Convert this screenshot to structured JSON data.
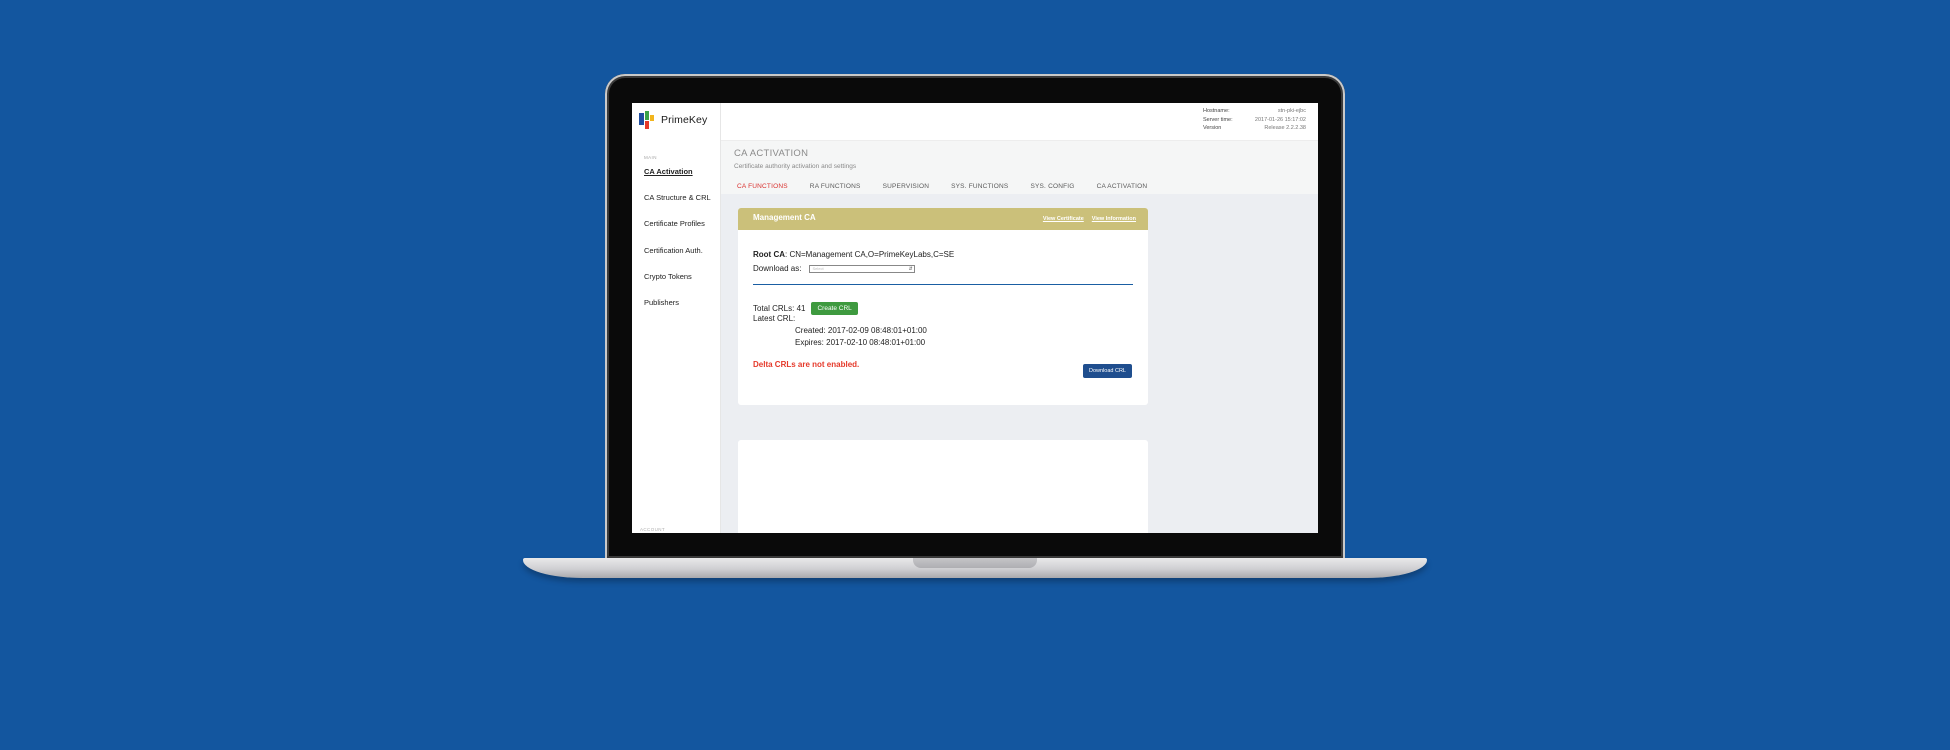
{
  "app": {
    "brand": "PrimeKey"
  },
  "server": {
    "hostname_label": "Hostname:",
    "hostname_value": "stn-pki-ejbc",
    "time_label": "Server time:",
    "time_value": "2017-01-26 15:17:02",
    "version_label": "Version",
    "version_value": "Release 2.2.2.38"
  },
  "sidebar": {
    "section": "MAIN",
    "items": [
      {
        "label": "CA Activation"
      },
      {
        "label": "CA Structure & CRL"
      },
      {
        "label": "Certificate Profiles"
      },
      {
        "label": "Certification Auth."
      },
      {
        "label": "Crypto Tokens"
      },
      {
        "label": "Publishers"
      }
    ],
    "footer": "ACCOUNT"
  },
  "page": {
    "title": "CA ACTIVATION",
    "subtitle": "Certificate authority activation and settings",
    "tabs": [
      {
        "label": "CA FUNCTIONS",
        "active": true
      },
      {
        "label": "RA FUNCTIONS"
      },
      {
        "label": "SUPERVISION"
      },
      {
        "label": "SYS. FUNCTIONS"
      },
      {
        "label": "SYS. CONFIG"
      },
      {
        "label": "CA ACTIVATION"
      }
    ]
  },
  "card": {
    "title": "Management CA",
    "link_view_certificate": "View Certificate",
    "link_view_information": "View Information",
    "root_label": "Root CA",
    "root_value": ": CN=Management CA,O=PrimeKeyLabs,C=SE",
    "download_label": "Download as:",
    "download_placeholder": "Select",
    "total_crls": "Total CRLs: 41",
    "create_crl": "Create CRL",
    "latest_crl": "Latest CRL:",
    "created": "Created: 2017-02-09 08:48:01+01:00",
    "expires": "Expires: 2017-02-10 08:48:01+01:00",
    "delta_notice": "Delta CRLs are not enabled.",
    "download_crl": "Download CRL"
  },
  "colors": {
    "background": "#13569f",
    "card_header": "#cbc07a",
    "active_tab": "#d9302e",
    "create_button": "#3e9a3f",
    "download_button": "#1f4e8e",
    "warning": "#e5392a"
  }
}
